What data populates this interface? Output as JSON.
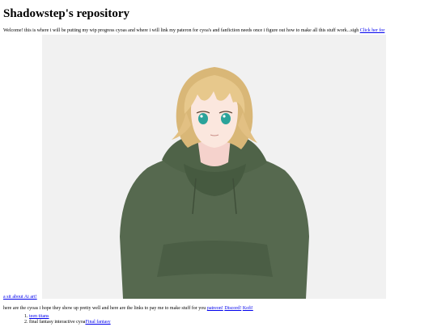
{
  "page": {
    "title": "Shadowstep's repository",
    "intro_text": "Welcome! this is where i will be putting my wip progress cyoas and where i will link my pateron for cyoa's and fanfiction needs once i figure out how to make all this stuff work...sigh ",
    "ai_link_part1": "Click her for",
    "ai_link_part2": "a sit about Ai art!",
    "support_text": "here are the cyoas i hope they show up pretty well and here are the links to pay me to make stuff for you ",
    "support_links": [
      "patreon!",
      "Discord!",
      "Kofi!"
    ],
    "cyoa_list": [
      {
        "text": "teen titans",
        "link": ""
      },
      {
        "text": "final fantasy interactive cyoa",
        "link": "Final fantasy"
      }
    ]
  },
  "colors": {
    "link": "#0000ee",
    "hero_bg": "#f1f1f1",
    "hair": "#e7c88c",
    "hoodie": "#556b4f",
    "eyes": "#2aa39a"
  }
}
